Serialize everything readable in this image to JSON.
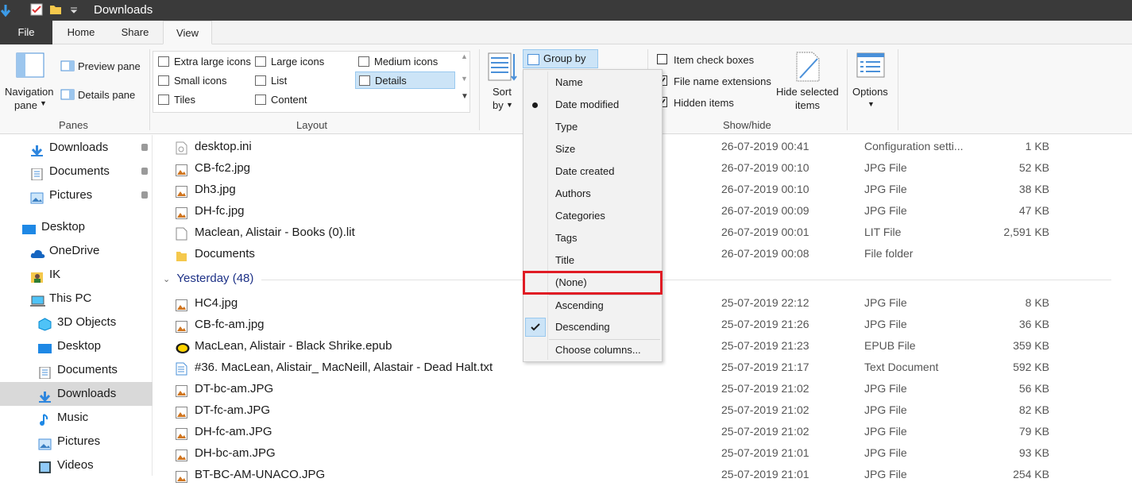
{
  "window": {
    "title": "Downloads"
  },
  "tabs": {
    "file": "File",
    "home": "Home",
    "share": "Share",
    "view": "View"
  },
  "ribbon": {
    "panes": {
      "navigation_pane_line1": "Navigation",
      "navigation_pane_line2": "pane",
      "preview_pane": "Preview pane",
      "details_pane": "Details pane",
      "group_label": "Panes"
    },
    "layout": {
      "items": [
        "Extra large icons",
        "Large icons",
        "Medium icons",
        "Small icons",
        "List",
        "Details",
        "Tiles",
        "Content"
      ],
      "selected": "Details",
      "group_label": "Layout"
    },
    "current_view": {
      "sort_by_line1": "Sort",
      "sort_by_line2": "by",
      "group_by": "Group by"
    },
    "show_hide": {
      "item_check_boxes": "Item check boxes",
      "file_name_extensions": "File name extensions",
      "hidden_items": "Hidden items",
      "hide_selected_line1": "Hide selected",
      "hide_selected_line2": "items",
      "group_label": "Show/hide",
      "item_check_boxes_checked": false,
      "file_name_extensions_checked": true,
      "hidden_items_checked": true
    },
    "options": "Options"
  },
  "group_by_menu": {
    "items": [
      "Name",
      "Date modified",
      "Type",
      "Size",
      "Date created",
      "Authors",
      "Categories",
      "Tags",
      "Title",
      "(None)"
    ],
    "selected_bullet": "Date modified",
    "order_items": [
      "Ascending",
      "Descending"
    ],
    "order_checked": "Descending",
    "choose_columns": "Choose columns..."
  },
  "sidebar": {
    "items": [
      "Downloads",
      "Documents",
      "Pictures",
      "Desktop",
      "OneDrive",
      "IK",
      "This PC",
      "3D Objects",
      "Desktop",
      "Documents",
      "Downloads",
      "Music",
      "Pictures",
      "Videos"
    ],
    "selected": "Downloads"
  },
  "files_top": [
    {
      "name": "desktop.ini",
      "date": "26-07-2019 00:41",
      "type": "Configuration setti...",
      "size": "1 KB"
    },
    {
      "name": "CB-fc2.jpg",
      "date": "26-07-2019 00:10",
      "type": "JPG File",
      "size": "52 KB"
    },
    {
      "name": "Dh3.jpg",
      "date": "26-07-2019 00:10",
      "type": "JPG File",
      "size": "38 KB"
    },
    {
      "name": "DH-fc.jpg",
      "date": "26-07-2019 00:09",
      "type": "JPG File",
      "size": "47 KB"
    },
    {
      "name": "Maclean, Alistair - Books (0).lit",
      "date": "26-07-2019 00:01",
      "type": "LIT File",
      "size": "2,591 KB"
    },
    {
      "name": "Documents",
      "date": "26-07-2019 00:08",
      "type": "File folder",
      "size": ""
    }
  ],
  "group_header": "Yesterday (48)",
  "files_yesterday": [
    {
      "name": "HC4.jpg",
      "date": "25-07-2019 22:12",
      "type": "JPG File",
      "size": "8 KB"
    },
    {
      "name": "CB-fc-am.jpg",
      "date": "25-07-2019 21:26",
      "type": "JPG File",
      "size": "36 KB"
    },
    {
      "name": "MacLean, Alistair - Black Shrike.epub",
      "date": "25-07-2019 21:23",
      "type": "EPUB File",
      "size": "359 KB"
    },
    {
      "name": "#36. MacLean, Alistair_ MacNeill, Alastair - Dead Halt.txt",
      "date": "25-07-2019 21:17",
      "type": "Text Document",
      "size": "592 KB"
    },
    {
      "name": "DT-bc-am.JPG",
      "date": "25-07-2019 21:02",
      "type": "JPG File",
      "size": "56 KB"
    },
    {
      "name": "DT-fc-am.JPG",
      "date": "25-07-2019 21:02",
      "type": "JPG File",
      "size": "82 KB"
    },
    {
      "name": "DH-fc-am.JPG",
      "date": "25-07-2019 21:02",
      "type": "JPG File",
      "size": "79 KB"
    },
    {
      "name": "DH-bc-am.JPG",
      "date": "25-07-2019 21:01",
      "type": "JPG File",
      "size": "93 KB"
    },
    {
      "name": "BT-BC-AM-UNACO.JPG",
      "date": "25-07-2019 21:01",
      "type": "JPG File",
      "size": "254 KB"
    }
  ],
  "colors": {
    "accent": "#0078d7",
    "selection": "#cce4f7",
    "highlight_box": "#e01b24",
    "group_header": "#1e3287"
  }
}
